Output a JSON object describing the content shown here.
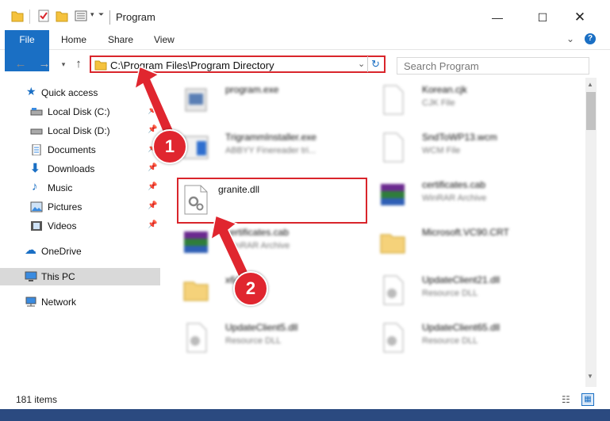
{
  "window": {
    "title": "Program"
  },
  "ribbon": {
    "tabs": [
      "File",
      "Home",
      "Share",
      "View"
    ]
  },
  "address": {
    "path": "C:\\Program Files\\Program Directory"
  },
  "search": {
    "placeholder": "Search Program"
  },
  "sidebar": {
    "items": [
      {
        "label": "Quick access",
        "icon": "star-icon"
      },
      {
        "label": "Local Disk (C:)",
        "icon": "drive-icon",
        "pinned": true
      },
      {
        "label": "Local Disk (D:)",
        "icon": "drive-icon",
        "pinned": true
      },
      {
        "label": "Documents",
        "icon": "documents-icon",
        "pinned": true
      },
      {
        "label": "Downloads",
        "icon": "downloads-icon",
        "pinned": true
      },
      {
        "label": "Music",
        "icon": "music-icon",
        "pinned": true
      },
      {
        "label": "Pictures",
        "icon": "pictures-icon",
        "pinned": true
      },
      {
        "label": "Videos",
        "icon": "videos-icon",
        "pinned": true
      },
      {
        "label": "OneDrive",
        "icon": "cloud-icon"
      },
      {
        "label": "This PC",
        "icon": "pc-icon",
        "selected": true
      },
      {
        "label": "Network",
        "icon": "network-icon"
      }
    ]
  },
  "files": [
    {
      "name": "program.exe",
      "type": "",
      "icon": "exe-icon"
    },
    {
      "name": "Korean.cjk",
      "type": "CJK File",
      "icon": "blank-file-icon"
    },
    {
      "name": "TrigrammInstaller.exe",
      "type": "ABBYY Finereader tri...",
      "icon": "installer-icon"
    },
    {
      "name": "SndToWP13.wcm",
      "type": "WCM File",
      "icon": "blank-file-icon"
    },
    {
      "name": "granite.dll",
      "type": "",
      "icon": "dll-gear-icon"
    },
    {
      "name": "certificates.cab",
      "type": "WinRAR Archive",
      "icon": "winrar-icon"
    },
    {
      "name": "certificates.cab",
      "type": "WinRAR Archive",
      "icon": "winrar-icon"
    },
    {
      "name": "Microsoft.VC90.CRT",
      "type": "",
      "icon": "folder-icon"
    },
    {
      "name": "x64",
      "type": "",
      "icon": "folder-icon"
    },
    {
      "name": "UpdateClient21.dll",
      "type": "Resource DLL",
      "icon": "dll-gear-icon"
    },
    {
      "name": "UpdateClient5.dll",
      "type": "Resource DLL",
      "icon": "dll-gear-icon"
    },
    {
      "name": "UpdateClient65.dll",
      "type": "Resource DLL",
      "icon": "dll-gear-icon"
    }
  ],
  "status": {
    "count": "181 items"
  },
  "annotations": {
    "one": "1",
    "two": "2"
  },
  "colors": {
    "accent": "#1a6fc4",
    "highlight": "#d9252b"
  }
}
